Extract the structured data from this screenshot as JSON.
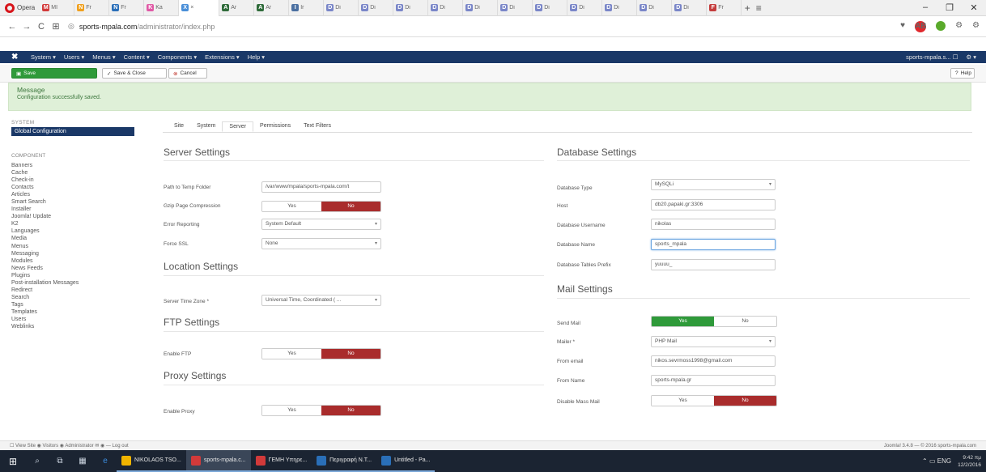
{
  "browser": {
    "menu_label": "Opera",
    "tabs": [
      {
        "label": "MI",
        "color": "#d23a3a",
        "glyph": "M"
      },
      {
        "label": "Fr",
        "color": "#f0a01e",
        "glyph": "N"
      },
      {
        "label": "Fr",
        "color": "#2a6fb8",
        "glyph": "N"
      },
      {
        "label": "Ka",
        "color": "#e05aa6",
        "glyph": "K"
      },
      {
        "label": "×",
        "color": "#4a8fd8",
        "glyph": "X"
      },
      {
        "label": "Ar",
        "color": "#2f6b3a",
        "glyph": "A"
      },
      {
        "label": "Ar",
        "color": "#2f6b3a",
        "glyph": "A"
      },
      {
        "label": "Ir",
        "color": "#4a6fa0",
        "glyph": "I"
      },
      {
        "label": "Di",
        "color": "#7a86c8",
        "glyph": "D"
      },
      {
        "label": "Di",
        "color": "#7a86c8",
        "glyph": "D"
      },
      {
        "label": "Di",
        "color": "#7a86c8",
        "glyph": "D"
      },
      {
        "label": "Di",
        "color": "#7a86c8",
        "glyph": "D"
      },
      {
        "label": "Di",
        "color": "#7a86c8",
        "glyph": "D"
      },
      {
        "label": "Di",
        "color": "#7a86c8",
        "glyph": "D"
      },
      {
        "label": "Di",
        "color": "#7a86c8",
        "glyph": "D"
      },
      {
        "label": "Di",
        "color": "#7a86c8",
        "glyph": "D"
      },
      {
        "label": "Di",
        "color": "#7a86c8",
        "glyph": "D"
      },
      {
        "label": "Di",
        "color": "#7a86c8",
        "glyph": "D"
      },
      {
        "label": "Di",
        "color": "#7a86c8",
        "glyph": "D"
      },
      {
        "label": "Fr",
        "color": "#c43c3c",
        "glyph": "F"
      }
    ],
    "url_host": "sports-mpala.com",
    "url_path": "/administrator/index.php"
  },
  "jmenu": {
    "items": [
      "System ▾",
      "Users ▾",
      "Menus ▾",
      "Content ▾",
      "Components ▾",
      "Extensions ▾",
      "Help ▾"
    ],
    "site": "sports-mpala.s... ☐",
    "gear": "⚙ ▾"
  },
  "toolbar": {
    "save": "Save",
    "save_close": "Save & Close",
    "cancel": "Cancel",
    "help": "Help"
  },
  "message": {
    "heading": "Message",
    "body": "Configuration successfully saved."
  },
  "sidebar": {
    "system_header": "SYSTEM",
    "active_item": "Global Configuration",
    "component_header": "COMPONENT",
    "items": [
      "Banners",
      "Cache",
      "Check-in",
      "Contacts",
      "Articles",
      "Smart Search",
      "Installer",
      "Joomla! Update",
      "K2",
      "Languages",
      "Media",
      "Menus",
      "Messaging",
      "Modules",
      "News Feeds",
      "Plugins",
      "Post-installation Messages",
      "Redirect",
      "Search",
      "Tags",
      "Templates",
      "Users",
      "Weblinks"
    ]
  },
  "tabs": [
    "Site",
    "System",
    "Server",
    "Permissions",
    "Text Filters"
  ],
  "server": {
    "title": "Server Settings",
    "tmp_label": "Path to Temp Folder",
    "tmp_value": "/var/www/mpala/sports-mpala.com/t",
    "gzip_label": "Gzip Page Compression",
    "error_label": "Error Reporting",
    "error_value": "System Default",
    "ssl_label": "Force SSL",
    "ssl_value": "None"
  },
  "location": {
    "title": "Location Settings",
    "tz_label": "Server Time Zone *",
    "tz_value": "Universal Time, Coordinated ( ..."
  },
  "ftp": {
    "title": "FTP Settings",
    "enable_label": "Enable FTP"
  },
  "proxy": {
    "title": "Proxy Settings",
    "enable_label": "Enable Proxy"
  },
  "database": {
    "title": "Database Settings",
    "type_label": "Database Type",
    "type_value": "MySQLi",
    "host_label": "Host",
    "host_value": "db20.papaki.gr:3306",
    "user_label": "Database Username",
    "user_value": "nikolas",
    "name_label": "Database Name",
    "name_value": "sports_mpala",
    "prefix_label": "Database Tables Prefix",
    "prefix_value": "yuuuu_"
  },
  "mail": {
    "title": "Mail Settings",
    "send_label": "Send Mail",
    "mailer_label": "Mailer *",
    "mailer_value": "PHP Mail",
    "from_email_label": "From email",
    "from_email_value": "nikos.sevrmoss1998@gmail.com",
    "from_name_label": "From Name",
    "from_name_value": "sports-mpala.gr",
    "mass_label": "Disable Mass Mail"
  },
  "toggle": {
    "yes": "Yes",
    "no": "No"
  },
  "footer": {
    "left": "☐ View Site  ◉ Visitors  ◉ Administrator  ✉ ◉  — Log out",
    "right": "Joomla! 3.4.8 — © 2016 sports-mpala.com"
  },
  "taskbar": {
    "apps": [
      {
        "label": "NIKOLAOS TSO...",
        "color": "#f0b400"
      },
      {
        "label": "sports-mpala.c...",
        "color": "#d23a3a",
        "active": true
      },
      {
        "label": "ΓΕΜΗ Υπηρε...",
        "color": "#d23a3a"
      },
      {
        "label": "Περιγραφή N.T...",
        "color": "#2a6fb8"
      },
      {
        "label": "Untitled - Pa...",
        "color": "#2a6fb8"
      }
    ],
    "tray": "⌃  ▭  ENG",
    "time": "9:42 πμ",
    "date": "12/2/2016"
  },
  "colors": {
    "joomla_nav": "#1a3867",
    "save_green": "#2f9a3a",
    "no_red": "#a92c2c",
    "message_bg": "#dff0d8"
  }
}
